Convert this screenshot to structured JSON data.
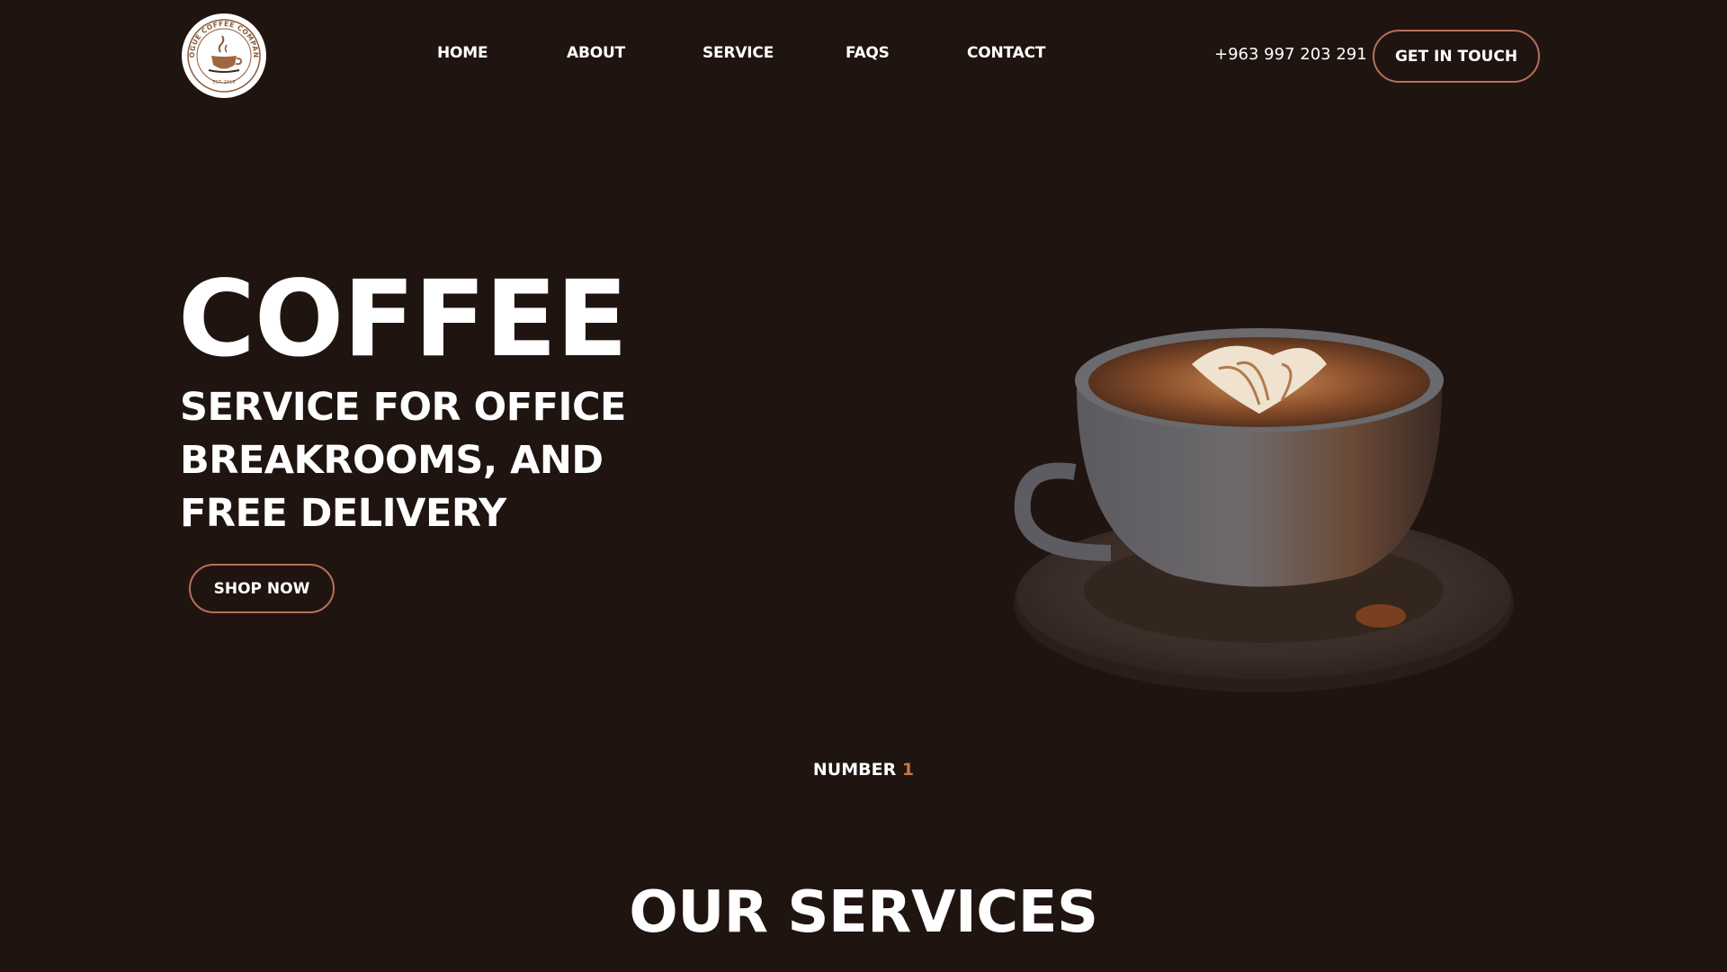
{
  "brand": {
    "logo_ring_text": "ROGUE COFFEE COMPANY",
    "logo_est_text": "EST. 2019"
  },
  "nav": {
    "items": [
      {
        "label": "HOME"
      },
      {
        "label": "ABOUT"
      },
      {
        "label": "SERVICE"
      },
      {
        "label": "FAQS"
      },
      {
        "label": "CONTACT"
      }
    ]
  },
  "header": {
    "phone": "+963 997 203 291",
    "cta_label": "GET IN TOUCH"
  },
  "hero": {
    "title": "COFFEE",
    "subtitle": "SERVICE FOR OFFICE BREAKROOMS, AND FREE DELIVERY",
    "shop_label": "SHOP NOW",
    "image_icon": "coffee-cup-latte-art-icon"
  },
  "ranking": {
    "label": "NUMBER",
    "value": "1"
  },
  "services": {
    "title": "OUR SERVICES"
  },
  "colors": {
    "background": "#1f1410",
    "accent": "#b5705a",
    "accent_text": "#c9763f",
    "text": "#ffffff"
  }
}
